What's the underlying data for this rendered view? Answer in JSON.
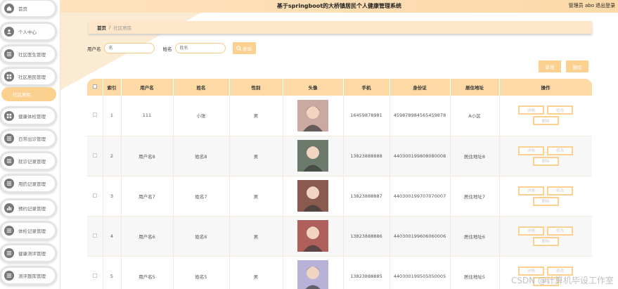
{
  "header": {
    "title": "基于springboot的大桥镇居民个人健康管理系统",
    "user": "管理员 abo",
    "logout": "退出登录"
  },
  "sidebar": {
    "items": [
      {
        "label": "首页",
        "icon": "home-icon"
      },
      {
        "label": "个人中心",
        "icon": "user-icon"
      },
      {
        "label": "社区医生管理",
        "icon": "list-icon"
      },
      {
        "label": "社区居民管理",
        "icon": "grid-icon"
      },
      {
        "label": "健康体检管理",
        "icon": "grid-icon"
      },
      {
        "label": "日常出诊管理",
        "icon": "list-icon"
      },
      {
        "label": "就诊记录管理",
        "icon": "list-icon"
      },
      {
        "label": "用药记录管理",
        "icon": "list-icon"
      },
      {
        "label": "预约记录管理",
        "icon": "chart-icon"
      },
      {
        "label": "体检记录管理",
        "icon": "list-icon"
      },
      {
        "label": "健康测评管理",
        "icon": "list-icon"
      },
      {
        "label": "测评题库管理",
        "icon": "list-icon"
      }
    ],
    "active_sub": "社区居民"
  },
  "breadcrumb": {
    "home": "首页",
    "sep": "/",
    "current": "社区居民"
  },
  "search": {
    "username_label": "用户名",
    "username_placeholder": "名",
    "name_label": "姓名",
    "name_placeholder": "姓名",
    "query_button": "查询"
  },
  "toolbar": {
    "add": "新增",
    "delete": "删除"
  },
  "table": {
    "headers": [
      "",
      "索引",
      "用户名",
      "姓名",
      "性别",
      "头像",
      "手机",
      "身份证",
      "居住地址",
      "操作"
    ],
    "rows": [
      {
        "index": "1",
        "username": "111",
        "name": "小张",
        "gender": "男",
        "phone": "16459878981",
        "idcard": "459878984565459878",
        "address": "A小区",
        "avatar_color": "#c9a9a0"
      },
      {
        "index": "2",
        "username": "用户名8",
        "name": "姓名8",
        "gender": "男",
        "phone": "13823888888",
        "idcard": "440300199808080008",
        "address": "居住地址8",
        "avatar_color": "#6b7a6a"
      },
      {
        "index": "3",
        "username": "用户名7",
        "name": "姓名7",
        "gender": "男",
        "phone": "13823888887",
        "idcard": "440300199707070007",
        "address": "居住地址7",
        "avatar_color": "#8a5a4e"
      },
      {
        "index": "4",
        "username": "用户名6",
        "name": "姓名6",
        "gender": "男",
        "phone": "13823888886",
        "idcard": "440300199606060006",
        "address": "居住地址6",
        "avatar_color": "#b0605a"
      },
      {
        "index": "5",
        "username": "用户名5",
        "name": "姓名5",
        "gender": "男",
        "phone": "13823888885",
        "idcard": "440300199505050005",
        "address": "居住地址5",
        "avatar_color": "#b9b2d8"
      }
    ],
    "actions": [
      "详情",
      "修改",
      "删除"
    ]
  },
  "watermark": "CSDN @计算机毕设工作室"
}
